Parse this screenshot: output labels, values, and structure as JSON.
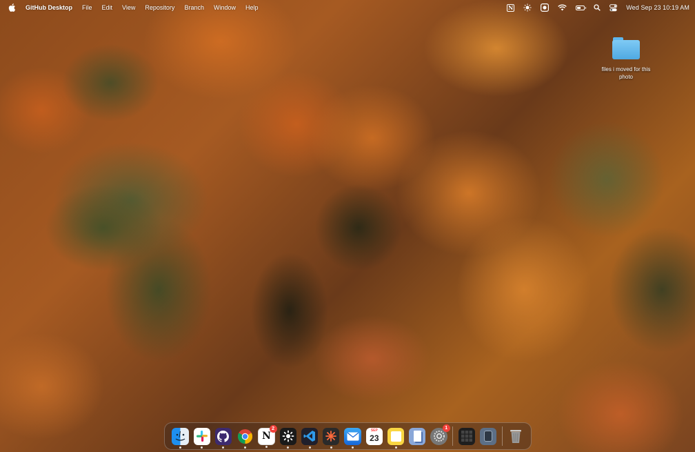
{
  "menubar": {
    "app_name": "GitHub Desktop",
    "menus": [
      "File",
      "Edit",
      "View",
      "Repository",
      "Branch",
      "Window",
      "Help"
    ],
    "status_icons": [
      "notion-icon",
      "brightness-icon",
      "record-icon",
      "wifi-icon",
      "battery-icon",
      "search-icon",
      "control-center-icon"
    ],
    "battery_level": 0.45,
    "datetime": "Wed Sep 23  10:19 AM"
  },
  "desktop": {
    "folder_label": "files i moved for this photo",
    "folder_color": "#5fb6ec"
  },
  "dock": {
    "apps": [
      {
        "name": "Finder",
        "icon": "finder-icon",
        "badge": ""
      },
      {
        "name": "Slack",
        "icon": "slack-icon",
        "badge": ""
      },
      {
        "name": "GitHub Desktop",
        "icon": "github-icon",
        "badge": ""
      },
      {
        "name": "Chrome",
        "icon": "chrome-icon",
        "badge": ""
      },
      {
        "name": "Notion",
        "icon": "notion-icon",
        "badge": "2"
      },
      {
        "name": "Sunflower",
        "icon": "sunflower-icon",
        "badge": ""
      },
      {
        "name": "VS Code",
        "icon": "vscode-icon",
        "badge": ""
      },
      {
        "name": "Spark",
        "icon": "spark-icon",
        "badge": ""
      },
      {
        "name": "Mail",
        "icon": "mail-icon",
        "badge": ""
      },
      {
        "name": "Calendar",
        "icon": "calendar-icon",
        "badge": "",
        "day": "23"
      },
      {
        "name": "Notes",
        "icon": "notes-icon",
        "badge": ""
      },
      {
        "name": "Preview",
        "icon": "preview-icon",
        "badge": ""
      },
      {
        "name": "System Preferences",
        "icon": "settings-icon",
        "badge": "1"
      }
    ],
    "folders": [
      {
        "name": "Stack",
        "icon": "stack-icon"
      },
      {
        "name": "Downloads",
        "icon": "downloads-icon"
      }
    ],
    "trash": {
      "name": "Trash",
      "icon": "trash-icon"
    }
  }
}
